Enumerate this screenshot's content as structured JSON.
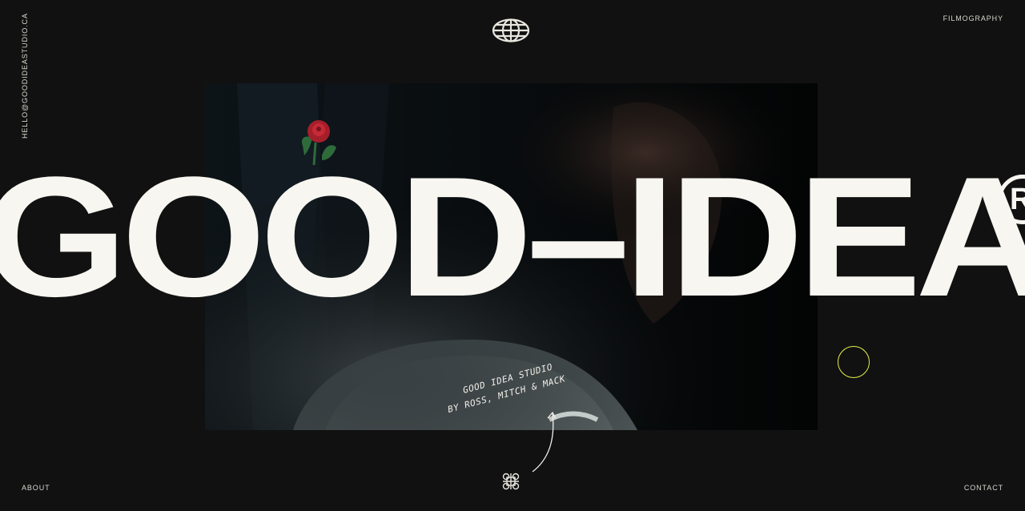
{
  "nav": {
    "email": "HELLO@GOODIDEASTUDIO.CA",
    "filmography": "FILMOGRAPHY",
    "about": "ABOUT",
    "contact": "CONTACT"
  },
  "hero": {
    "wordmark": "GOOD–IDEA",
    "registered_mark": "R"
  },
  "note": {
    "line1": "GOOD IDEA STUDIO",
    "line2": "BY ROSS, MITCH & MACK"
  },
  "icons": {
    "top_logo": "globe-icon",
    "bottom_logo": "knot-icon",
    "cursor": "cursor-ring-icon"
  },
  "colors": {
    "background": "#111111",
    "text": "#f7f6f0",
    "accent": "#e3f04a"
  }
}
